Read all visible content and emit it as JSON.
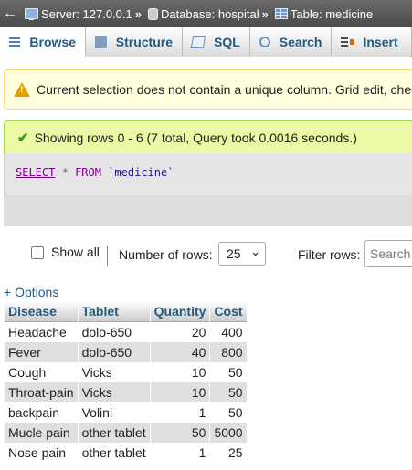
{
  "breadcrumb": {
    "back_glyph": "←",
    "server": "Server: 127.0.0.1",
    "database": "Database: hospital",
    "table": "Table: medicine",
    "separator": "»"
  },
  "tabs": [
    {
      "label": "Browse",
      "icon": "browse-icon",
      "active": true
    },
    {
      "label": "Structure",
      "icon": "structure-icon"
    },
    {
      "label": "SQL",
      "icon": "sql-icon"
    },
    {
      "label": "Search",
      "icon": "search-icon"
    },
    {
      "label": "Insert",
      "icon": "insert-icon"
    }
  ],
  "warning": {
    "icon": "warning-icon",
    "text": "Current selection does not contain a unique column. Grid edit, checkbox"
  },
  "success": {
    "icon": "checkmark-icon",
    "text": "Showing rows 0 - 6 (7 total, Query took 0.0016 seconds.)"
  },
  "sql": {
    "select": "SELECT",
    "star": "*",
    "from": "FROM",
    "table": "`medicine`"
  },
  "controls": {
    "show_all": "Show all",
    "number_of_rows_label": "Number of rows:",
    "number_of_rows_value": "25",
    "filter_label": "Filter rows:",
    "search_placeholder": "Search"
  },
  "options_link": "+ Options",
  "table": {
    "headers": [
      "Disease",
      "Tablet",
      "Quantity",
      "Cost"
    ],
    "rows": [
      [
        "Headache",
        "dolo-650",
        "20",
        "400"
      ],
      [
        "Fever",
        "dolo-650",
        "40",
        "800"
      ],
      [
        "Cough",
        "Vicks",
        "10",
        "50"
      ],
      [
        "Throat-pain",
        "Vicks",
        "10",
        "50"
      ],
      [
        "backpain",
        "Volini",
        "1",
        "50"
      ],
      [
        "Mucle pain",
        "other tablet",
        "50",
        "5000"
      ],
      [
        "Nose pain",
        "other tablet",
        "1",
        "25"
      ]
    ]
  },
  "colors": {
    "link": "#235a81",
    "warning_bg": "#ffffdd",
    "success_bg": "#ebf8a4",
    "row_alt": "#dfdfdf"
  }
}
